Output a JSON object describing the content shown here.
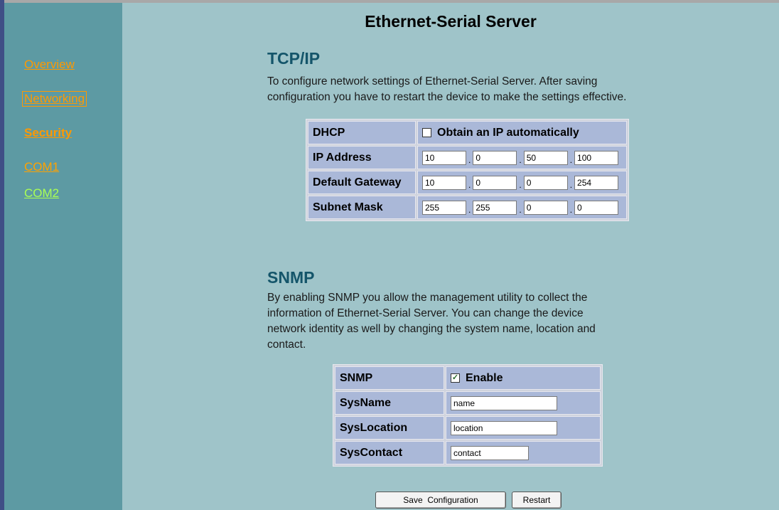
{
  "page_title": "Ethernet-Serial Server",
  "sidebar": {
    "items": [
      {
        "label": "Overview"
      },
      {
        "label": "Networking"
      },
      {
        "label": "Security"
      },
      {
        "label": "COM1"
      },
      {
        "label": "COM2"
      }
    ]
  },
  "tcpip": {
    "heading": "TCP/IP",
    "desc_line1": "To configure network settings of Ethernet-Serial Server. After saving",
    "desc_line2": "configuration you have to restart the device to make the settings effective.",
    "dhcp_label": "DHCP",
    "dhcp_option": "Obtain an IP automatically",
    "dhcp_checked": false,
    "ip_label": "IP Address",
    "ip": [
      "10",
      "0",
      "50",
      "100"
    ],
    "gateway_label": "Default Gateway",
    "gateway": [
      "10",
      "0",
      "0",
      "254"
    ],
    "mask_label": "Subnet Mask",
    "mask": [
      "255",
      "255",
      "0",
      "0"
    ],
    "separator": "."
  },
  "snmp": {
    "heading": "SNMP",
    "desc_line1": "By enabling SNMP you allow the management utility to collect the",
    "desc_line2": "information of Ethernet-Serial Server. You can change the device",
    "desc_line3": "network identity as well by changing the system name, location and",
    "desc_line4": "contact.",
    "snmp_label": "SNMP",
    "enable_label": "Enable",
    "enable_checked": true,
    "check_mark": "✓",
    "sysname_label": "SysName",
    "sysname_value": "name",
    "syslocation_label": "SysLocation",
    "syslocation_value": "location",
    "syscontact_label": "SysContact",
    "syscontact_value": "contact"
  },
  "buttons": {
    "save": "Save  Configuration",
    "restart": "Restart"
  },
  "colors": {
    "content_bg": "#9fc4c9",
    "sidebar_bg": "#5d9aa3",
    "heading": "#14556a",
    "link": "#ff9900",
    "link_com2": "#aaff55",
    "table_cell": "#aab8d8"
  }
}
